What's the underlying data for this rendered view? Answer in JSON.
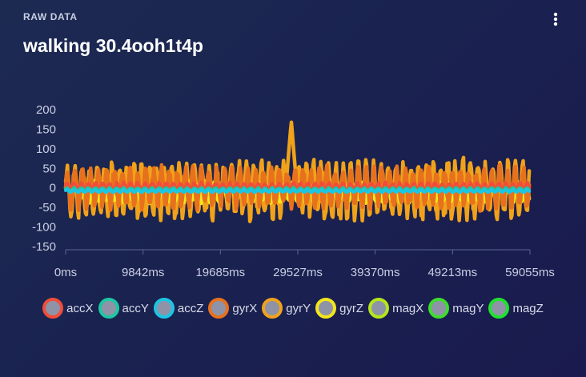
{
  "header": {
    "section_label": "RAW DATA",
    "title": "walking 30.4ooh1t4p"
  },
  "menu": {
    "icon": "more-vertical-icon"
  },
  "chart_data": {
    "type": "line",
    "x_unit": "ms",
    "xlim": [
      0,
      59055
    ],
    "ylim": [
      -150,
      200
    ],
    "y_ticks": [
      200,
      150,
      100,
      50,
      0,
      -50,
      -100,
      -150
    ],
    "x_ticks": [
      0,
      9842,
      19685,
      29527,
      39370,
      49213,
      59055
    ],
    "x_tick_labels": [
      "0ms",
      "9842ms",
      "19685ms",
      "29527ms",
      "39370ms",
      "49213ms",
      "59055ms"
    ],
    "grid": false,
    "legend_position": "bottom",
    "series": [
      {
        "name": "accX",
        "color": "#f04e3a",
        "amplitude": 12,
        "offset": 3,
        "period_ms": 900
      },
      {
        "name": "accY",
        "color": "#1ec7a2",
        "amplitude": 5,
        "offset": -4,
        "period_ms": 900
      },
      {
        "name": "accZ",
        "color": "#1bc6e4",
        "amplitude": 4,
        "offset": -8,
        "period_ms": 900
      },
      {
        "name": "gyrX",
        "color": "#e8711d",
        "amplitude": 60,
        "offset": 0,
        "period_ms": 1000
      },
      {
        "name": "gyrY",
        "color": "#f0a31a",
        "amplitude": 85,
        "offset": -5,
        "period_ms": 950,
        "peak": {
          "x": 28700,
          "y": 170
        }
      },
      {
        "name": "gyrZ",
        "color": "#f1e61c",
        "amplitude": 30,
        "offset": -10,
        "period_ms": 1100
      },
      {
        "name": "magX",
        "color": "#b4e61a",
        "amplitude": 0,
        "offset": 0,
        "period_ms": 1000
      },
      {
        "name": "magY",
        "color": "#3edc2f",
        "amplitude": 0,
        "offset": 0,
        "period_ms": 1000
      },
      {
        "name": "magZ",
        "color": "#1fe22c",
        "amplitude": 0,
        "offset": 0,
        "period_ms": 1000
      }
    ]
  }
}
